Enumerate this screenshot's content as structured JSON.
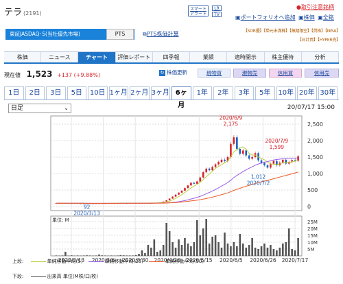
{
  "stock": {
    "name": "テラ",
    "code": "(2191)"
  },
  "header": {
    "smart_alert": "スマート アラート",
    "lr": "LR",
    "tv": "TV",
    "caution": "取引注意銘柄",
    "portfolio_add": "ポートフォリオへ追加",
    "quote": "株価",
    "all": "全銘"
  },
  "market": {
    "name": "東証JASDAQ･S(当社優先市場)",
    "pts": "PTS",
    "pts_calc": "PTS株価計算"
  },
  "tags": {
    "row1": "【SOR優】【単元未満株】【無期限空】【貸株】【NISA】",
    "row2": "【日計買】【HYPER売】"
  },
  "tabs": [
    "株価",
    "ニュース",
    "チャート",
    "評価レポート",
    "四季報",
    "業績",
    "適時開示",
    "株主優待",
    "分析"
  ],
  "active_tab": "チャート",
  "price": {
    "label": "現在値",
    "value": "1,523",
    "change": "+137 (+9.88%)"
  },
  "actions": {
    "refresh": "株価更新",
    "buy": "現物買",
    "sell": "現物売",
    "margin_buy": "信用買",
    "margin_sell": "信用売"
  },
  "periods": [
    "1日",
    "2日",
    "3日",
    "5日",
    "10日",
    "1ヶ月",
    "2ヶ月",
    "3ヶ月",
    "6ヶ月",
    "1年",
    "2年",
    "3年",
    "5年",
    "10年",
    "20年",
    "30年"
  ],
  "active_period": "6ヶ月",
  "chart_controls": {
    "interval": "日足",
    "timestamp": "20/07/17 15:00",
    "volume_unit": "単位: M"
  },
  "chart_data": {
    "type": "candlestick",
    "price_ticks": [
      "2,500",
      "2,000",
      "1,500",
      "1,000",
      "500",
      "0"
    ],
    "price_tick_values": [
      2500,
      2000,
      1500,
      1000,
      500,
      0
    ],
    "price_ylim": [
      0,
      2500
    ],
    "volume_ticks": [
      "25M",
      "20M",
      "15M",
      "10M",
      "5M"
    ],
    "volume_tick_values": [
      25,
      20,
      15,
      10,
      5
    ],
    "volume_ylim": [
      0,
      27
    ],
    "x_ticks": [
      "2020/2/13",
      "2020/3/6",
      "2020/3/30",
      "2020/4/20",
      "2020/5/15",
      "2020/6/5",
      "2020/6/26",
      "2020/7/17"
    ],
    "annotations": [
      {
        "label": "2020/6/9\n2,175",
        "value": 2175
      },
      {
        "label": "2020/7/9\n1,599",
        "value": 1599
      },
      {
        "label": "1,012\n2020/7/2",
        "value": 1012
      },
      {
        "label": "92\n2020/3/13",
        "value": 92
      }
    ],
    "close": [
      100,
      102,
      98,
      101,
      99,
      97,
      100,
      96,
      95,
      94,
      92,
      95,
      93,
      96,
      98,
      97,
      99,
      101,
      98,
      100,
      99,
      102,
      101,
      100,
      103,
      104,
      102,
      105,
      106,
      104,
      108,
      110,
      112,
      115,
      125,
      150,
      190,
      240,
      300,
      360,
      420,
      480,
      560,
      640,
      720,
      690,
      760,
      880,
      1040,
      1150,
      1100,
      1200,
      1280,
      1350,
      1420,
      1380,
      1500,
      1900,
      2100,
      1750,
      1600,
      1700,
      1550,
      1450,
      1500,
      1620,
      1400,
      1320,
      1250,
      1180,
      1300,
      1380,
      1250,
      1330,
      1420,
      1300,
      1350,
      1410,
      1390,
      1523
    ],
    "volume_m": [
      0.3,
      0.2,
      0.3,
      3,
      0.2,
      0.4,
      0.2,
      0.3,
      0.2,
      0.3,
      0.4,
      0.3,
      0.2,
      0.3,
      1,
      0.4,
      0.3,
      0.2,
      0.3,
      0.2,
      0.3,
      0.5,
      0.4,
      0.3,
      0.3,
      0.3,
      0.6,
      1.5,
      4,
      2,
      8,
      6,
      12,
      3,
      4,
      8,
      24,
      18,
      10,
      6,
      12,
      8,
      13,
      9,
      7,
      10,
      26,
      15,
      20,
      27,
      9,
      14,
      15,
      10,
      6,
      17,
      9,
      7,
      10,
      7,
      16,
      9,
      6,
      8,
      13,
      6,
      5,
      7,
      9,
      6,
      8,
      5,
      4,
      6,
      9,
      10,
      20,
      5,
      4,
      13
    ],
    "series": [
      {
        "name": "単純移動平均(5)",
        "color": "#b9cf3a"
      },
      {
        "name": "単純移動平均(25)",
        "color": "#9a5ce6"
      },
      {
        "name": "単純移動平均(50)",
        "color": "#ee5a24"
      },
      {
        "name": "出来高 単位(M株/口/枚)",
        "color": "#555555"
      }
    ],
    "legend_upper": "上段:",
    "legend_lower": "下段:"
  }
}
